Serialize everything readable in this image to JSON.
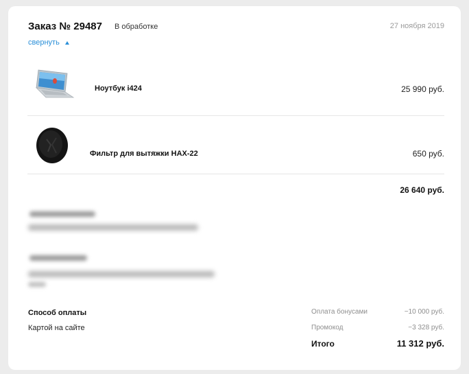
{
  "order": {
    "title": "Заказ № 29487",
    "status": "В обработке",
    "date": "27 ноября 2019",
    "collapse_label": "свернуть",
    "accent_color": "#2a8fd8"
  },
  "items": [
    {
      "name": "Ноутбук i424",
      "price": "25 990 руб.",
      "image": "laptop-image"
    },
    {
      "name": "Фильтр для вытяжки HAX-22",
      "price": "650 руб.",
      "image": "filter-image"
    }
  ],
  "subtotal": "26 640 руб.",
  "payment": {
    "label": "Способ оплаты",
    "value": "Картой на сайте"
  },
  "summary": {
    "bonus_label": "Оплата бонусами",
    "bonus_value": "−10 000 руб.",
    "promo_label": "Промокод",
    "promo_value": "−3 328 руб.",
    "total_label": "Итого",
    "total_value": "11 312 руб."
  }
}
